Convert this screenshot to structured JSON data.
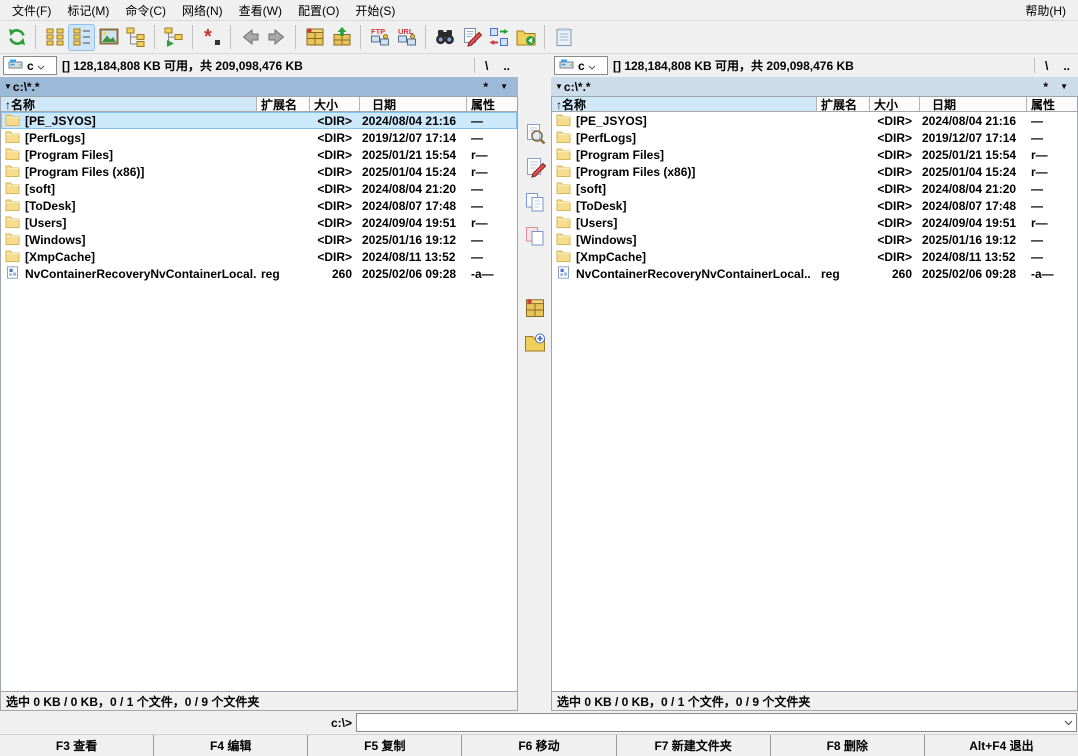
{
  "window": {
    "help_menu": "帮助(H)"
  },
  "menu_bar": {
    "items": [
      {
        "id": "file",
        "label": "文件(F)"
      },
      {
        "id": "mark",
        "label": "标记(M)"
      },
      {
        "id": "commands",
        "label": "命令(C)"
      },
      {
        "id": "net",
        "label": "网络(N)"
      },
      {
        "id": "show",
        "label": "查看(W)"
      },
      {
        "id": "configuration",
        "label": "配置(O)"
      },
      {
        "id": "start",
        "label": "开始(S)"
      }
    ]
  },
  "toolbar": {
    "groups": [
      [
        {
          "name": "refresh-icon"
        }
      ],
      [
        {
          "name": "brief-view-icon"
        },
        {
          "name": "full-view-icon",
          "active": true
        },
        {
          "name": "thumbnail-view-icon"
        },
        {
          "name": "tree-view-icon"
        }
      ],
      [
        {
          "name": "dir-branch-icon"
        }
      ],
      [
        {
          "name": "select-pattern-icon"
        }
      ],
      [
        {
          "name": "back-icon"
        },
        {
          "name": "forward-icon"
        }
      ],
      [
        {
          "name": "pack-icon"
        },
        {
          "name": "unpack-icon"
        }
      ],
      [
        {
          "name": "ftp-connect-icon"
        },
        {
          "name": "ftp-url-icon"
        }
      ],
      [
        {
          "name": "search-icon"
        },
        {
          "name": "multi-rename-icon"
        },
        {
          "name": "sync-dirs-icon"
        },
        {
          "name": "dir-contents-icon"
        }
      ],
      [
        {
          "name": "notes-icon"
        }
      ]
    ]
  },
  "columns": [
    {
      "id": "name",
      "label": "名称",
      "sort_arrow": "↑"
    },
    {
      "id": "ext",
      "label": "扩展名",
      "sort_arrow": ""
    },
    {
      "id": "size",
      "label": "大小",
      "sort_arrow": ""
    },
    {
      "id": "date",
      "label": "日期",
      "sort_arrow": ""
    },
    {
      "id": "attr",
      "label": "属性",
      "sort_arrow": ""
    }
  ],
  "rows": [
    {
      "icon": "folder-icon",
      "name": "[PE_JSYOS]",
      "ext": "",
      "size": "<DIR>",
      "date": "2024/08/04 21:16",
      "attr": "—"
    },
    {
      "icon": "folder-icon",
      "name": "[PerfLogs]",
      "ext": "",
      "size": "<DIR>",
      "date": "2019/12/07 17:14",
      "attr": "—"
    },
    {
      "icon": "folder-icon",
      "name": "[Program Files]",
      "ext": "",
      "size": "<DIR>",
      "date": "2025/01/21 15:54",
      "attr": "r—"
    },
    {
      "icon": "folder-icon",
      "name": "[Program Files (x86)]",
      "ext": "",
      "size": "<DIR>",
      "date": "2025/01/04 15:24",
      "attr": "r—"
    },
    {
      "icon": "folder-icon",
      "name": "[soft]",
      "ext": "",
      "size": "<DIR>",
      "date": "2024/08/04 21:20",
      "attr": "—"
    },
    {
      "icon": "folder-icon",
      "name": "[ToDesk]",
      "ext": "",
      "size": "<DIR>",
      "date": "2024/08/07 17:48",
      "attr": "—"
    },
    {
      "icon": "folder-icon",
      "name": "[Users]",
      "ext": "",
      "size": "<DIR>",
      "date": "2024/09/04 19:51",
      "attr": "r—"
    },
    {
      "icon": "folder-icon",
      "name": "[Windows]",
      "ext": "",
      "size": "<DIR>",
      "date": "2025/01/16 19:12",
      "attr": "—"
    },
    {
      "icon": "folder-icon",
      "name": "[XmpCache]",
      "ext": "",
      "size": "<DIR>",
      "date": "2024/08/11 13:52",
      "attr": "—"
    },
    {
      "icon": "reg-file-icon",
      "name": "NvContainerRecoveryNvContainerLocal..",
      "ext": "reg",
      "size": "260",
      "date": "2025/02/06 09:28",
      "attr": "-a—"
    }
  ],
  "panels": {
    "left": {
      "drive": {
        "selected": "c",
        "info": "[] 128,184,808 KB 可用，共 209,098,476 KB"
      },
      "path": "c:\\*.*",
      "active": true,
      "cursor_row": 0,
      "status": "选中 0 KB / 0 KB，0 / 1 个文件，0 / 9 个文件夹"
    },
    "right": {
      "drive": {
        "selected": "c",
        "info": "[] 128,184,808 KB 可用，共 209,098,476 KB"
      },
      "path": "c:\\*.*",
      "active": false,
      "cursor_row": null,
      "status": "选中 0 KB / 0 KB，0 / 1 个文件，0 / 9 个文件夹"
    }
  },
  "panel_buttons": {
    "root": "\\",
    "parent": "..",
    "favorites": "*",
    "history": "▼",
    "path_marker": "▼"
  },
  "middle_toolbar": {
    "icons": [
      {
        "name": "view-file-icon"
      },
      {
        "name": "edit-file-icon"
      },
      {
        "name": "copy-files-icon"
      },
      {
        "name": "move-files-icon",
        "gap_before": false
      },
      {
        "name": "pack-files-icon",
        "gap_before": true
      },
      {
        "name": "new-folder-icon"
      }
    ]
  },
  "command_line": {
    "prompt": "c:\\>",
    "value": ""
  },
  "function_bar": {
    "buttons": [
      {
        "id": "f3-view",
        "label": "F3 查看"
      },
      {
        "id": "f4-edit",
        "label": "F4 编辑"
      },
      {
        "id": "f5-copy",
        "label": "F5 复制"
      },
      {
        "id": "f6-move",
        "label": "F6 移动"
      },
      {
        "id": "f7-new-folder",
        "label": "F7 新建文件夹"
      },
      {
        "id": "f8-delete",
        "label": "F8 删除"
      },
      {
        "id": "alt-f4-exit",
        "label": "Alt+F4 退出"
      }
    ]
  },
  "colors": {
    "active_path_bg": "#9cb9d8",
    "inactive_path_bg": "#cddcea",
    "sorted_header_bg": "#cfe7f6",
    "cursor_row_bg": "#cce8fb",
    "cursor_row_border": "#84c2ec",
    "folder_icon_yellow": "#f6dd8d",
    "refresh_green": "#2aa03c",
    "toolbar_bg": "#f0f0f0"
  }
}
